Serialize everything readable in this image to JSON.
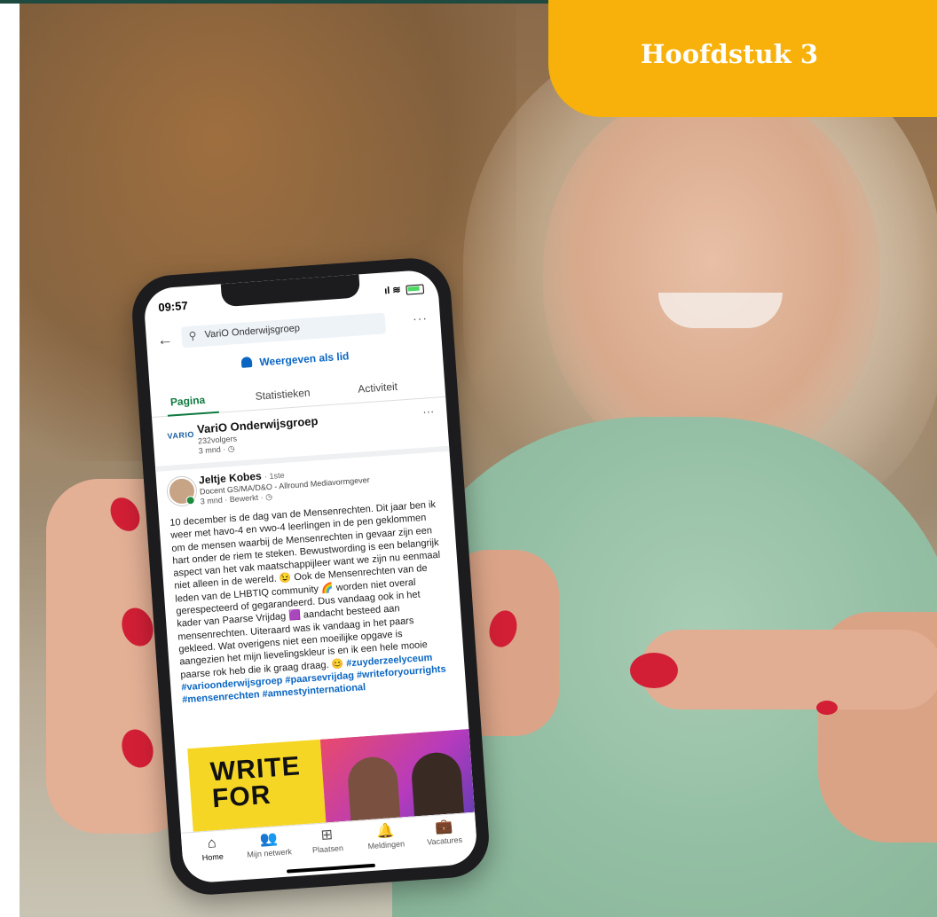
{
  "chapter": {
    "label": "Hoofdstuk 3"
  },
  "phone": {
    "status": {
      "time": "09:57",
      "signal": "ıl"
    },
    "search": {
      "query": "VariO Onderwijsgroep",
      "more": "···"
    },
    "view_as_member": "Weergeven als lid",
    "tabs": [
      {
        "label": "Pagina",
        "active": true
      },
      {
        "label": "Statistieken",
        "active": false
      },
      {
        "label": "Activiteit",
        "active": false
      }
    ],
    "company": {
      "logo": "VARIO",
      "name": "VariO Onderwijsgroep",
      "followers": "232volgers",
      "age": "3 mnd · ◷",
      "more": "···"
    },
    "post": {
      "author": "Jeltje Kobes",
      "degree": "· 1ste",
      "title": "Docent GS/MA/D&O - Allround Mediavormgever",
      "meta": "3 mnd · Bewerkt · ◷",
      "body": "10 december is de dag van de Mensenrechten. Dit jaar ben ik weer met havo-4 en vwo-4 leerlingen in de pen geklommen om de mensen waarbij de Mensenrechten in gevaar zijn een hart onder de riem te steken. Bewustwording is een belangrijk aspect van het vak maatschappijleer want we zijn nu eenmaal niet alleen in de wereld. 😉 Ook de Mensenrechten van de leden van de LHBTIQ community 🌈 worden niet overal gerespecteerd of gegarandeerd. Dus vandaag ook in het kader van Paarse Vrijdag 🟪 aandacht besteed aan mensenrechten. Uiteraard was ik vandaag in het paars gekleed. Wat overigens niet een moeilijke opgave is aangezien het mijn lievelingskleur is en ik een hele mooie paarse rok heb die ik graag draag.",
      "hashtags": "😊 #zuyderzeelyceum #varioonderwijsgroep #paarsevrijdag #writeforyourrights #mensenrechten #amnestyinternational",
      "image_text": "WRITE\nFOR"
    },
    "nav": [
      {
        "label": "Home",
        "icon": "⌂",
        "active": true
      },
      {
        "label": "Mijn netwerk",
        "icon": "👥",
        "active": false
      },
      {
        "label": "Plaatsen",
        "icon": "⊞",
        "active": false
      },
      {
        "label": "Meldingen",
        "icon": "🔔",
        "active": false
      },
      {
        "label": "Vacatures",
        "icon": "💼",
        "active": false
      }
    ]
  },
  "colors": {
    "chapter_tab": "#f7b10a",
    "linkedin_blue": "#0a66c2",
    "active_tab_green": "#0f7a40",
    "hoodie": "#93bea3",
    "nail_polish": "#d21f36"
  }
}
